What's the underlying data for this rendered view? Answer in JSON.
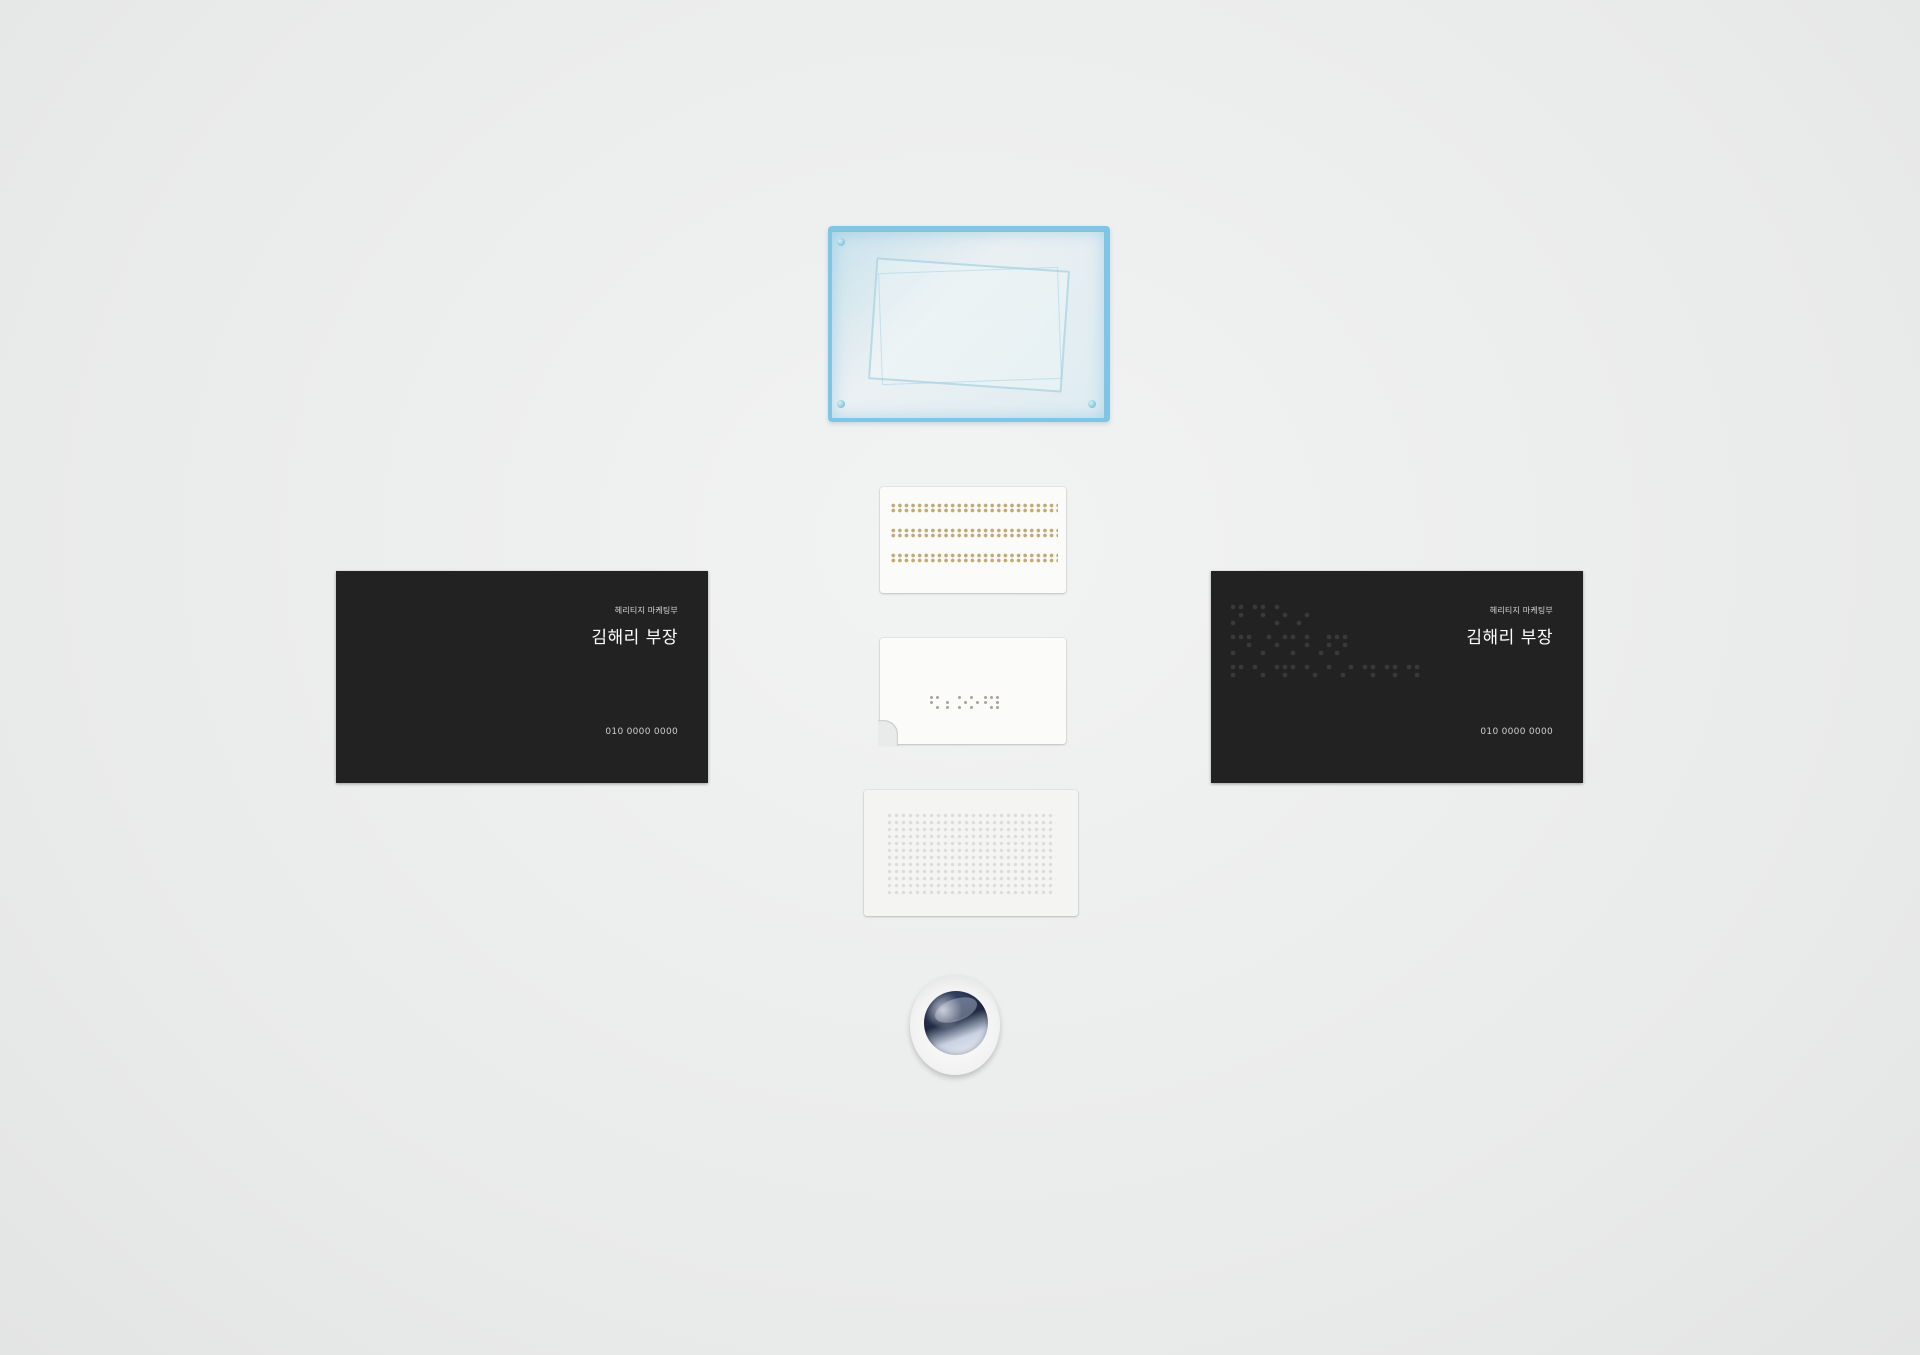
{
  "cards": {
    "left": {
      "department": "헤리티지 마케팅부",
      "name": "김해리 부장",
      "phone": "010 0000 0000"
    },
    "right": {
      "department": "헤리티지 마케팅부",
      "name": "김해리 부장",
      "phone": "010 0000 0000"
    }
  },
  "colors": {
    "background": "#e9eaea",
    "card_black": "#222222",
    "card_white": "#fbfbfa",
    "acrylic_blue": "#7fc6e6",
    "gold_dots": "#c2a872"
  }
}
